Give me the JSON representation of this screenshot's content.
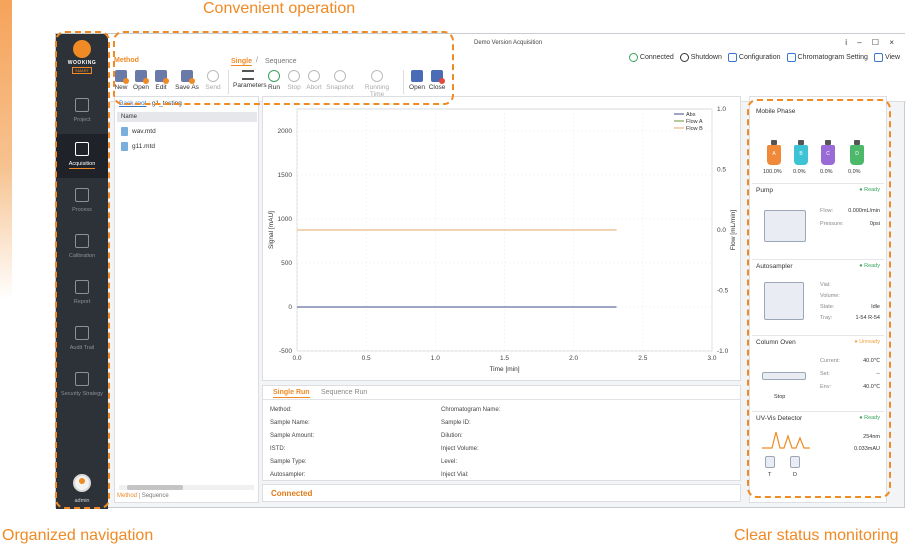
{
  "captions": {
    "top": "Convenient operation",
    "left": "Organized navigation",
    "right": "Clear status monitoring"
  },
  "brand": {
    "name": "WOOKING",
    "sub": "SMART"
  },
  "sidebar": {
    "items": [
      {
        "label": "Project",
        "icon": "project-icon"
      },
      {
        "label": "Acquisition",
        "icon": "flask-icon"
      },
      {
        "label": "Process",
        "icon": "process-icon"
      },
      {
        "label": "Calibration",
        "icon": "calibration-icon"
      },
      {
        "label": "Report",
        "icon": "report-icon"
      },
      {
        "label": "Audit Trail",
        "icon": "audit-icon"
      },
      {
        "label": "Security Strategy",
        "icon": "shield-icon"
      }
    ],
    "user": "admin"
  },
  "window": {
    "title": "Demo Version Acquisition",
    "controls": "i – ☐ ×"
  },
  "mode_tabs": {
    "method": "Method",
    "single": "Single",
    "sep": "/",
    "sequence": "Sequence"
  },
  "status_bar_top": {
    "connected": "Connected",
    "shutdown": "Shutdown",
    "configuration": "Configuration",
    "chromatogram_setting": "Chromatogram Setting",
    "view": "View"
  },
  "toolbar": {
    "new": "New",
    "open": "Open",
    "edit": "Edit",
    "save_as": "Save As",
    "send": "Send",
    "parameters": "Parameters",
    "run": "Run",
    "stop": "Stop",
    "abort": "Abort",
    "snapshot": "Snapshot",
    "running_time": "Running Time",
    "open2": "Open",
    "close": "Close"
  },
  "files": {
    "back": "Back root",
    "path": "g1_testing",
    "header": "Name",
    "items": [
      "wav.mtd",
      "g11.mtd"
    ],
    "tab_method": "Method",
    "tab_sequence": "Sequence"
  },
  "chart_data": {
    "type": "line",
    "xlabel": "Time [min]",
    "ylabel": "Signal [mAU]",
    "y2label": "Flow [mL/min]",
    "xlim": [
      0.0,
      3.0
    ],
    "ylim": [
      -500,
      2250
    ],
    "y2lim": [
      -1.0,
      1.0
    ],
    "x_ticks": [
      "0.0",
      "0.5",
      "1.0",
      "1.5",
      "2.0",
      "2.5",
      "3.0"
    ],
    "y_ticks": [
      "2000",
      "1500",
      "1000",
      "500",
      "0",
      "-500"
    ],
    "y2_ticks": [
      "1.0",
      "0.5",
      "0.0",
      "-0.5",
      "-1.0"
    ],
    "legend": [
      "Abs",
      "Flow A",
      "Flow B"
    ],
    "legend_position": "top-right",
    "series": [
      {
        "name": "Abs",
        "color": "#3b4a8a",
        "axis": "left",
        "x": [
          0.0,
          2.31
        ],
        "y": [
          0,
          0
        ]
      },
      {
        "name": "Flow A",
        "color": "#6b8f3a",
        "axis": "right",
        "x": [
          0.0,
          2.31
        ],
        "y": [
          0.0,
          0.0
        ]
      },
      {
        "name": "Flow B",
        "color": "#e6a86a",
        "axis": "right",
        "x": [
          0.0,
          2.31
        ],
        "y": [
          0.0,
          0.0
        ]
      }
    ]
  },
  "run_tabs": {
    "single": "Single Run",
    "sequence": "Sequence Run"
  },
  "run_fields": {
    "left": [
      "Method:",
      "Sample Name:",
      "Sample Amount:",
      "ISTD:",
      "Sample Type:",
      "Autosampler:"
    ],
    "right": [
      "Chromatogram Name:",
      "Sample ID:",
      "Dilution:",
      "Inject Volume:",
      "Level:",
      "Inject Vial:"
    ]
  },
  "connection_status": "Connected",
  "mobile_phase": {
    "title": "Mobile Phase",
    "bottles": [
      {
        "label": "A",
        "percent": "100.0%",
        "color": "#f08a3a"
      },
      {
        "label": "B",
        "percent": "0.0%",
        "color": "#3cc3d4"
      },
      {
        "label": "C",
        "percent": "0.0%",
        "color": "#9a6bd6"
      },
      {
        "label": "D",
        "percent": "0.0%",
        "color": "#4bb86a"
      }
    ]
  },
  "pump": {
    "title": "Pump",
    "status": "Ready",
    "flow_label": "Flow:",
    "flow_value": "0.000mL/min",
    "pressure_label": "Pressure:",
    "pressure_value": "0psi"
  },
  "autosampler": {
    "title": "Autosampler",
    "status": "Ready",
    "vial_label": "Vial:",
    "vial_value": "",
    "volume_label": "Volume:",
    "volume_value": "",
    "state_label": "State:",
    "state_value": "Idle",
    "tray_label": "Tray:",
    "tray_value": "1-54 R-54"
  },
  "column_oven": {
    "title": "Column Oven",
    "status": "Unready",
    "current_label": "Current:",
    "current_value": "40.0℃",
    "set_label": "Set:",
    "set_value": "--",
    "env_label": "Env:",
    "env_value": "40.0℃",
    "state": "Stop"
  },
  "uv_detector": {
    "title": "UV-Vis Detector",
    "status": "Ready",
    "wavelength": "254nm",
    "signal": "0.033mAU",
    "lamp_t": "T",
    "lamp_d": "D"
  }
}
